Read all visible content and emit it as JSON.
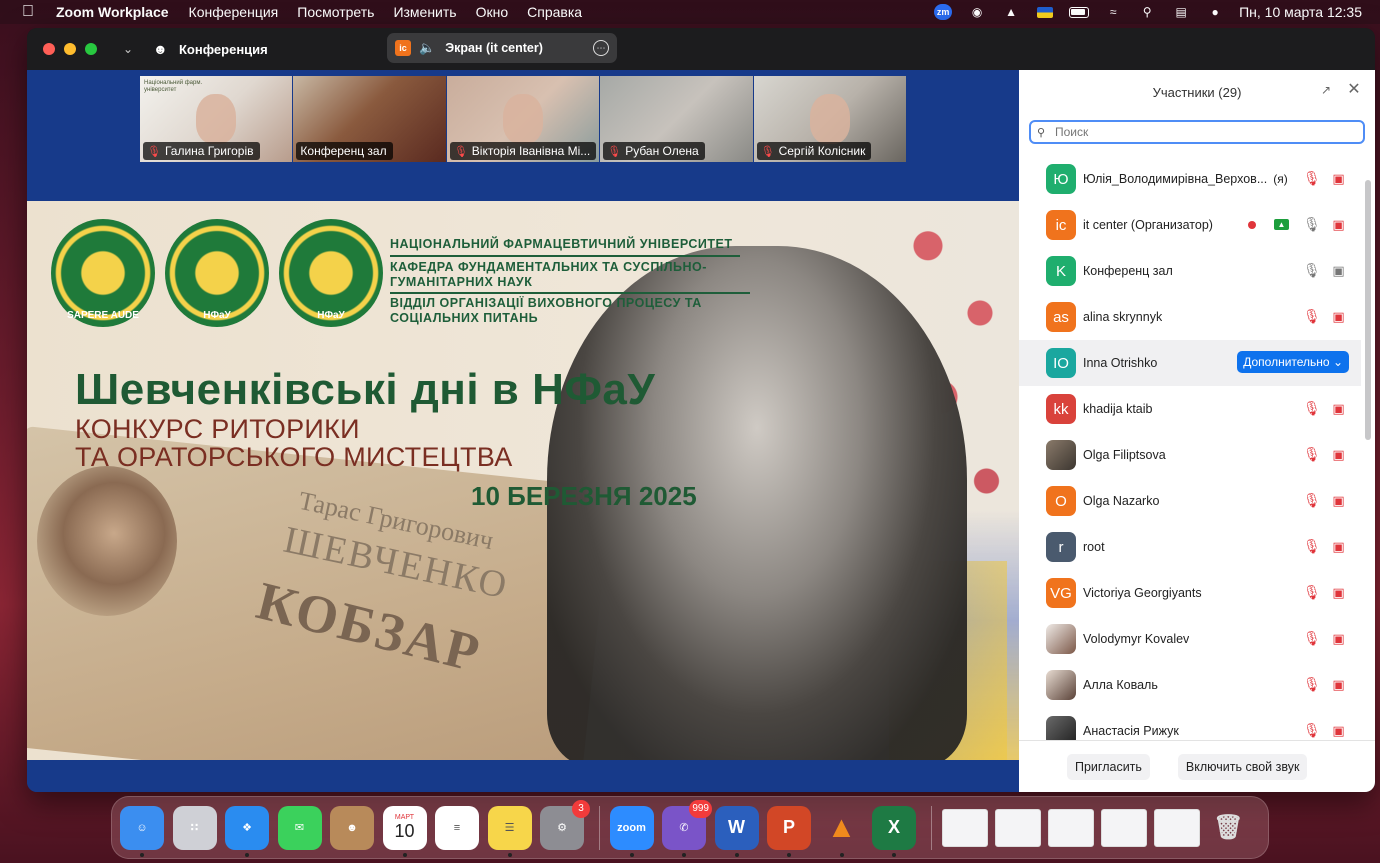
{
  "menubar": {
    "app_name": "Zoom Workplace",
    "items": [
      "Конференция",
      "Посмотреть",
      "Изменить",
      "Окно",
      "Справка"
    ],
    "zm_badge": "zm",
    "clock": "Пн, 10 марта  12:35"
  },
  "window": {
    "title": "Конференция",
    "screen_share_label": "Экран (it center)",
    "screen_share_badge": "ic"
  },
  "thumbnails": [
    {
      "name": "Галина Григорів",
      "muted": true
    },
    {
      "name": "Конференц зал",
      "muted": false
    },
    {
      "name": "Вікторія Іванівна Мі...",
      "muted": true
    },
    {
      "name": "Рубан Олена",
      "muted": true
    },
    {
      "name": "Сергій Колісник",
      "muted": true
    }
  ],
  "slide": {
    "university": "НАЦІОНАЛЬНИЙ ФАРМАЦЕВТИЧНИЙ УНІВЕРСИТЕТ",
    "department": "КАФЕДРА ФУНДАМЕНТАЛЬНИХ ТА СУСПІЛЬНО-ГУМАНІТАРНИХ НАУК",
    "division": "ВІДДІЛ ОРГАНІЗАЦІЇ ВИХОВНОГО ПРОЦЕСУ ТА СОЦІАЛЬНИХ ПИТАНЬ",
    "logo_labels": [
      "SAPERE AUDE",
      "НФаУ",
      "НФаУ"
    ],
    "title": "Шевченківські дні в НФаУ",
    "subtitle_line1": "КОНКУРС РИТОРИКИ",
    "subtitle_line2": "ТА ОРАТОРСЬКОГО МИСТЕЦТВА",
    "date": "10 БЕРЕЗНЯ 2025",
    "book_line1": "Тарас Григорович",
    "book_line2": "ШЕВЧЕНКО",
    "book_line3": "КОБЗАР"
  },
  "participants": {
    "header": "Участники (29)",
    "search_placeholder": "Поиск",
    "more_button": "Дополнительно",
    "invite_button": "Пригласить",
    "unmute_button": "Включить свой звук",
    "list": [
      {
        "initials": "Ю",
        "name": "Юлія_Володимирівна_Верхов...",
        "tag": "(я)",
        "color": "#1fae6e",
        "mic": "off",
        "cam": "off"
      },
      {
        "initials": "ic",
        "name": "it center (Организатор)",
        "tag": "",
        "color": "#f0731d",
        "mic": "on",
        "cam": "off",
        "recording": true,
        "sharing": true
      },
      {
        "initials": "K",
        "name": "Конференц зал",
        "tag": "",
        "color": "#1fae6e",
        "mic": "on",
        "cam": "on"
      },
      {
        "initials": "as",
        "name": "alina skrynnyk",
        "tag": "",
        "color": "#f0731d",
        "mic": "off",
        "cam": "off"
      },
      {
        "initials": "IO",
        "name": "Inna Otrishko",
        "tag": "",
        "color": "#1aa79f",
        "mic": "",
        "cam": "",
        "hover": true
      },
      {
        "initials": "kk",
        "name": "khadija ktaib",
        "tag": "",
        "color": "#d9423b",
        "mic": "off",
        "cam": "off"
      },
      {
        "initials": "",
        "name": "Olga Filiptsova",
        "tag": "",
        "color": "photo",
        "mic": "off",
        "cam": "off"
      },
      {
        "initials": "O",
        "name": "Olga Nazarko",
        "tag": "",
        "color": "#f0731d",
        "mic": "off",
        "cam": "off"
      },
      {
        "initials": "r",
        "name": "root",
        "tag": "",
        "color": "#4a5a6e",
        "mic": "off",
        "cam": "off"
      },
      {
        "initials": "VG",
        "name": "Victoriya Georgiyants",
        "tag": "",
        "color": "#f0731d",
        "mic": "off",
        "cam": "off"
      },
      {
        "initials": "",
        "name": "Volodymyr Kovalev",
        "tag": "",
        "color": "photo",
        "mic": "off",
        "cam": "off"
      },
      {
        "initials": "",
        "name": "Алла Коваль",
        "tag": "",
        "color": "photo",
        "mic": "off",
        "cam": "off"
      },
      {
        "initials": "",
        "name": "Анастасія Рижук",
        "tag": "",
        "color": "photo",
        "mic": "off",
        "cam": "off"
      }
    ]
  },
  "dock": {
    "apps": [
      {
        "name": "finder",
        "color": "#3b8ef0",
        "label": ""
      },
      {
        "name": "launchpad",
        "color": "#d9d9de",
        "label": ""
      },
      {
        "name": "safari",
        "color": "#2a8cf0",
        "label": ""
      },
      {
        "name": "messages",
        "color": "#3bd15c",
        "label": ""
      },
      {
        "name": "contacts",
        "color": "#b88a5a",
        "label": ""
      },
      {
        "name": "calendar",
        "color": "#ffffff",
        "label": "10",
        "top_label": "МАРТ"
      },
      {
        "name": "reminders",
        "color": "#ffffff",
        "label": ""
      },
      {
        "name": "notes",
        "color": "#f7d64a",
        "label": ""
      },
      {
        "name": "system-settings",
        "color": "#8d8d93",
        "label": "",
        "badge": "3"
      },
      {
        "name": "zoom",
        "color": "#2d8cff",
        "label": "zoom"
      },
      {
        "name": "viber",
        "color": "#7a54c8",
        "label": "",
        "badge": "999"
      },
      {
        "name": "word",
        "color": "#2b5fbd",
        "label": "W"
      },
      {
        "name": "powerpoint",
        "color": "#d24726",
        "label": "P"
      },
      {
        "name": "vlc",
        "color": "#f08a1d",
        "label": ""
      },
      {
        "name": "excel",
        "color": "#1e7a44",
        "label": "X"
      }
    ]
  }
}
